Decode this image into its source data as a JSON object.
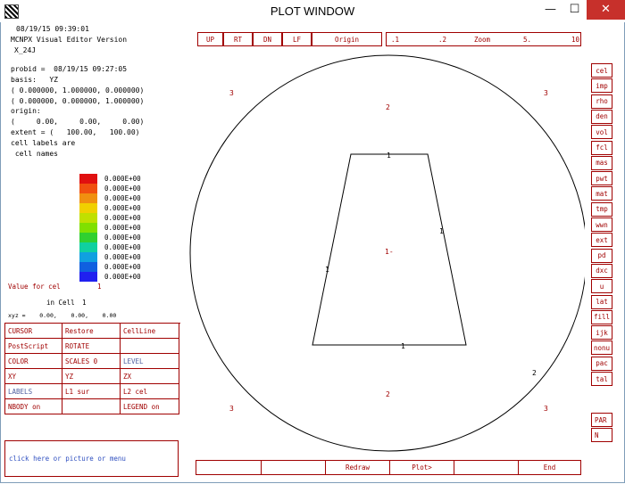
{
  "window": {
    "title": "PLOT WINDOW",
    "minimize": "—",
    "maximize": "☐",
    "close": "✕"
  },
  "info": {
    "datetime": "08/19/15 09:39:01",
    "version_line": "MCNPX Visual Editor Version",
    "version": "X_24J",
    "probid": "probid =  08/19/15 09:27:05",
    "basis_label": "basis:   YZ",
    "basis_v1": "( 0.000000, 1.000000, 0.000000)",
    "basis_v2": "( 0.000000, 0.000000, 1.000000)",
    "origin_label": "origin:",
    "origin_val": "(     0.00,     0.00,     0.00)",
    "extent": "extent = (   100.00,   100.00)",
    "cell_labels": "cell labels are",
    "cell_names": " cell names"
  },
  "legend": {
    "colors": [
      "#e01010",
      "#f05010",
      "#f09010",
      "#f0d000",
      "#c0e000",
      "#80e000",
      "#30d030",
      "#10d0a0",
      "#10a0e0",
      "#1060e0",
      "#2020f0"
    ],
    "values": [
      "0.000E+00",
      "0.000E+00",
      "0.000E+00",
      "0.000E+00",
      "0.000E+00",
      "0.000E+00",
      "0.000E+00",
      "0.000E+00",
      "0.000E+00",
      "0.000E+00",
      "0.000E+00"
    ]
  },
  "value_for": {
    "label": "Value for cel",
    "num": "1",
    "in_cell": "in Cell",
    "in_cell_num": "1",
    "xyz": "xyz =    0.00,    0.00,    0.00"
  },
  "button_grid": [
    [
      "CURSOR",
      "Restore",
      "CellLine"
    ],
    [
      "PostScript",
      "ROTATE",
      ""
    ],
    [
      "COLOR",
      "SCALES 0",
      "LEVEL"
    ],
    [
      "XY",
      "YZ",
      "ZX"
    ],
    [
      "LABELS",
      "L1 sur",
      "L2 cel"
    ],
    [
      "NBODY  on",
      "",
      "LEGEND  on"
    ]
  ],
  "message": "click here or picture or menu",
  "top_nav": {
    "up": "UP",
    "rt": "RT",
    "dn": "DN",
    "lf": "LF",
    "origin": "Origin"
  },
  "zoom": {
    "z1": ".1",
    "z2": ".2",
    "label": "Zoom",
    "z3": "5.",
    "z4": "10"
  },
  "right_menu": [
    "cel",
    "imp",
    "rho",
    "den",
    "vol",
    "fcl",
    "mas",
    "pwt",
    "mat",
    "tmp",
    "wwn",
    "ext",
    "pd",
    "dxc",
    "u",
    "lat",
    "fill",
    "ijk",
    "nonu",
    "pac",
    "tal"
  ],
  "right_bottom": [
    "PAR",
    "N"
  ],
  "bottom_bar": [
    "",
    "",
    "Redraw",
    "Plot>",
    "",
    "End"
  ],
  "plot_labels": {
    "tl": "3",
    "tr": "3",
    "bl": "3",
    "br": "3",
    "top2": "2",
    "bot2": "2",
    "right2": "2",
    "center": "1-",
    "edge_top": "1",
    "edge_left": "1",
    "edge_right": "1",
    "edge_bottom": "1"
  }
}
